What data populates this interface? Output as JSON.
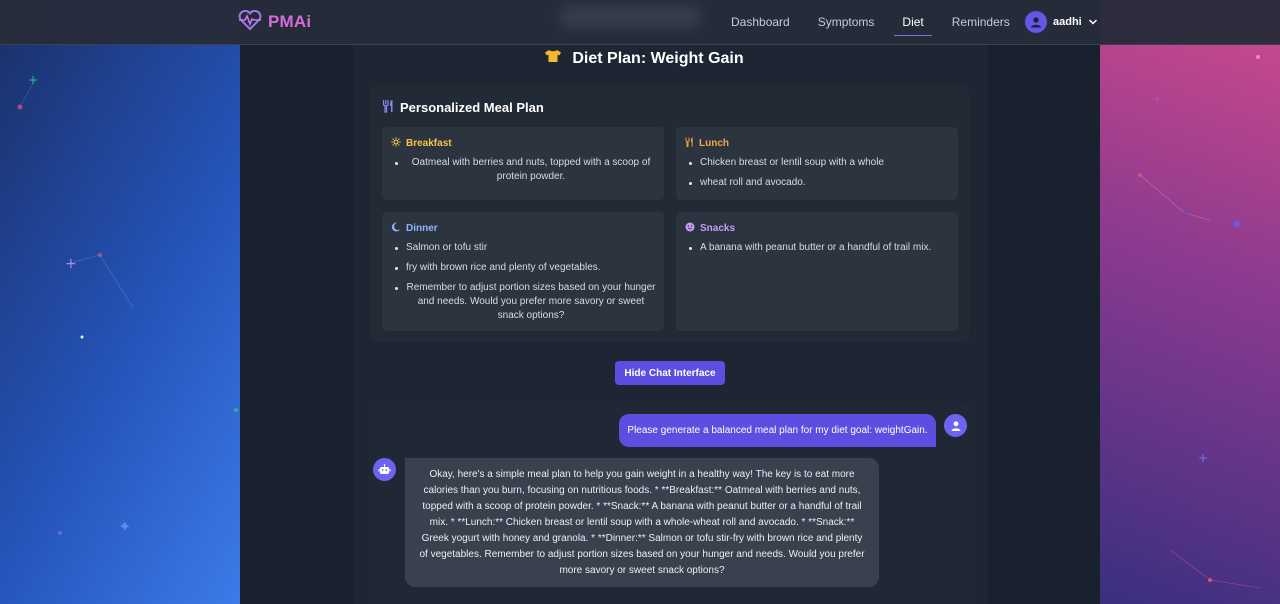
{
  "navbar": {
    "brand": "PMAi",
    "links": [
      "Dashboard",
      "Symptoms",
      "Diet",
      "Reminders"
    ],
    "active_link": "Diet",
    "user_name": "aadhi"
  },
  "page": {
    "title": "Diet Plan: Weight Gain"
  },
  "meal_plan": {
    "heading": "Personalized Meal Plan",
    "breakfast": {
      "title": "Breakfast",
      "items": [
        "Oatmeal with berries and nuts, topped with a scoop of protein powder."
      ]
    },
    "lunch": {
      "title": "Lunch",
      "items": [
        "Chicken breast or lentil soup with a whole",
        "wheat roll and avocado."
      ]
    },
    "dinner": {
      "title": "Dinner",
      "items": [
        "Salmon or tofu stir",
        "fry with brown rice and plenty of vegetables.",
        "Remember to adjust portion sizes based on your hunger and needs. Would you prefer more savory or sweet snack options?"
      ]
    },
    "snacks": {
      "title": "Snacks",
      "items": [
        "A banana with peanut butter or a handful of trail mix."
      ]
    }
  },
  "controls": {
    "hide_chat_label": "Hide Chat Interface"
  },
  "chat": {
    "user_message": "Please generate a balanced meal plan for my diet goal: weightGain.",
    "bot_message": "Okay, here's a simple meal plan to help you gain weight in a healthy way! The key is to eat more calories than you burn, focusing on nutritious foods. * **Breakfast:** Oatmeal with berries and nuts, topped with a scoop of protein powder. * **Snack:** A banana with peanut butter or a handful of trail mix. * **Lunch:** Chicken breast or lentil soup with a whole-wheat roll and avocado. * **Snack:** Greek yogurt with honey and granola. * **Dinner:** Salmon or tofu stir-fry with brown rice and plenty of vegetables. Remember to adjust portion sizes based on your hunger and needs. Would you prefer more savory or sweet snack options?"
  },
  "colors": {
    "accent": "#5b4ee0",
    "brand": "#d46cd8",
    "breakfast": "#f5c542",
    "lunch": "#f0a94a",
    "dinner": "#8fb4ff",
    "snacks": "#c79cf5"
  },
  "icons": {
    "brand": "heartbeat-icon",
    "title": "shirt-icon",
    "heading": "utensils-icon",
    "breakfast": "sun-icon",
    "lunch": "utensils-icon",
    "dinner": "moon-icon",
    "snacks": "smile-icon",
    "user": "user-icon",
    "bot": "robot-icon"
  }
}
